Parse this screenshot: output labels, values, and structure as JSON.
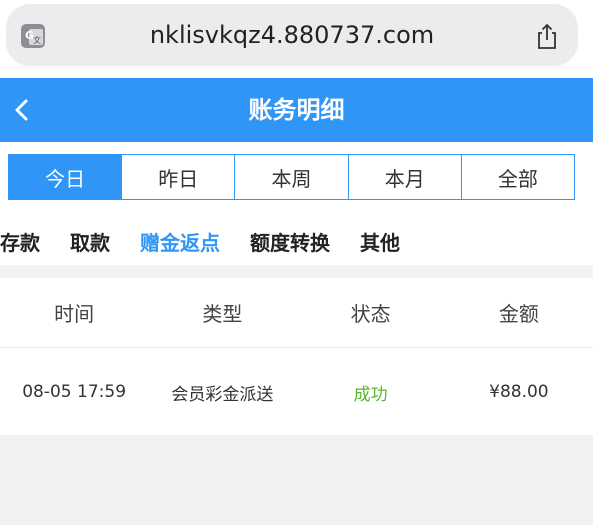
{
  "browser": {
    "url": "nklisvkqz4.880737.com",
    "translate_icon": "translate-icon",
    "share_icon": "share-icon"
  },
  "header": {
    "title": "账务明细",
    "back_icon": "chevron-left-icon",
    "background_color": "#2f95f7"
  },
  "date_tabs": [
    {
      "label": "今日",
      "active": true
    },
    {
      "label": "昨日",
      "active": false
    },
    {
      "label": "本周",
      "active": false
    },
    {
      "label": "本月",
      "active": false
    },
    {
      "label": "全部",
      "active": false
    }
  ],
  "category_tabs": [
    {
      "label": "存款",
      "active": false
    },
    {
      "label": "取款",
      "active": false
    },
    {
      "label": "赠金返点",
      "active": true
    },
    {
      "label": "额度转换",
      "active": false
    },
    {
      "label": "其他",
      "active": false
    }
  ],
  "table": {
    "columns": [
      "时间",
      "类型",
      "状态",
      "金额"
    ],
    "rows": [
      {
        "time": "08-05 17:59",
        "type": "会员彩金派送",
        "status": "成功",
        "amount": "¥88.00"
      }
    ]
  },
  "colors": {
    "accent": "#2f95f7",
    "success": "#5cb531"
  }
}
